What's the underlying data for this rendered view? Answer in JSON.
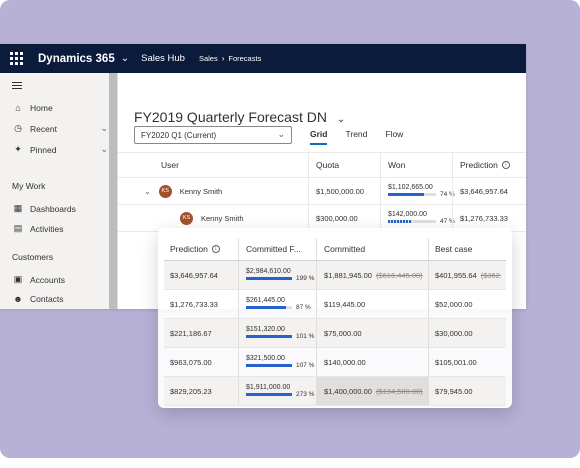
{
  "app": {
    "brand": "Dynamics 365",
    "app_name": "Sales Hub",
    "breadcrumb": [
      "Sales",
      "Forecasts"
    ]
  },
  "sidebar": {
    "items": [
      {
        "label": "Home",
        "icon": "home-icon"
      },
      {
        "label": "Recent",
        "icon": "clock-icon"
      },
      {
        "label": "Pinned",
        "icon": "pin-icon"
      }
    ],
    "sections": [
      {
        "title": "My Work",
        "items": [
          {
            "label": "Dashboards",
            "icon": "dashboard-icon"
          },
          {
            "label": "Activities",
            "icon": "clipboard-icon"
          }
        ]
      },
      {
        "title": "Customers",
        "items": [
          {
            "label": "Accounts",
            "icon": "building-icon"
          },
          {
            "label": "Contacts",
            "icon": "person-icon"
          }
        ]
      }
    ]
  },
  "forecast": {
    "title": "FY2019 Quarterly Forecast DN",
    "period": "FY2020 Q1 (Current)",
    "tabs": [
      "Grid",
      "Trend",
      "Flow"
    ],
    "active_tab": "Grid",
    "columns": [
      "User",
      "Quota",
      "Won",
      "Prediction"
    ],
    "rows": [
      {
        "user": "Kenny Smith",
        "initials": "KS",
        "quota": "$1,500,000.00",
        "won": "$1,102,665.00",
        "won_pct": "74 %",
        "won_fill": 0.74,
        "prediction": "$3,646,957.64"
      },
      {
        "user": "Kenny Smith",
        "initials": "KS",
        "quota": "$300,000.00",
        "won": "$142,000.00",
        "won_pct": "47 %",
        "won_fill": 0.47,
        "prediction": "$1,276,733.33"
      }
    ]
  },
  "detail": {
    "columns": [
      "Prediction",
      "Committed F...",
      "Committed",
      "Best case"
    ],
    "rows": [
      {
        "prediction": "$3,646,957.64",
        "cf": "$2,984,610.00",
        "cf_pct": "199 %",
        "cf_fill": 1.0,
        "committed": "$1,881,945.00",
        "committed_old": "($616,445.00)",
        "best": "$401,955.64",
        "best_old": "($362,"
      },
      {
        "prediction": "$1,276,733.33",
        "cf": "$261,445.00",
        "cf_pct": "87 %",
        "cf_fill": 0.87,
        "committed": "$119,445.00",
        "committed_old": "",
        "best": "$52,000.00",
        "best_old": ""
      },
      {
        "prediction": "$221,186.67",
        "cf": "$151,320.00",
        "cf_pct": "101 %",
        "cf_fill": 1.0,
        "committed": "$75,000.00",
        "committed_old": "",
        "best": "$30,000.00",
        "best_old": ""
      },
      {
        "prediction": "$963,075.00",
        "cf": "$321,500.00",
        "cf_pct": "107 %",
        "cf_fill": 1.0,
        "committed": "$140,000.00",
        "committed_old": "",
        "best": "$105,001.00",
        "best_old": ""
      },
      {
        "prediction": "$829,205.23",
        "cf": "$1,911,000.00",
        "cf_pct": "273 %",
        "cf_fill": 1.0,
        "committed": "$1,400,000.00",
        "committed_old": "($134,500.00)",
        "best": "$79,945.00",
        "best_old": ""
      }
    ]
  },
  "colors": {
    "topbar": "#0b1b3b",
    "accent": "#2564cf",
    "backdrop": "#b8b1d6"
  }
}
